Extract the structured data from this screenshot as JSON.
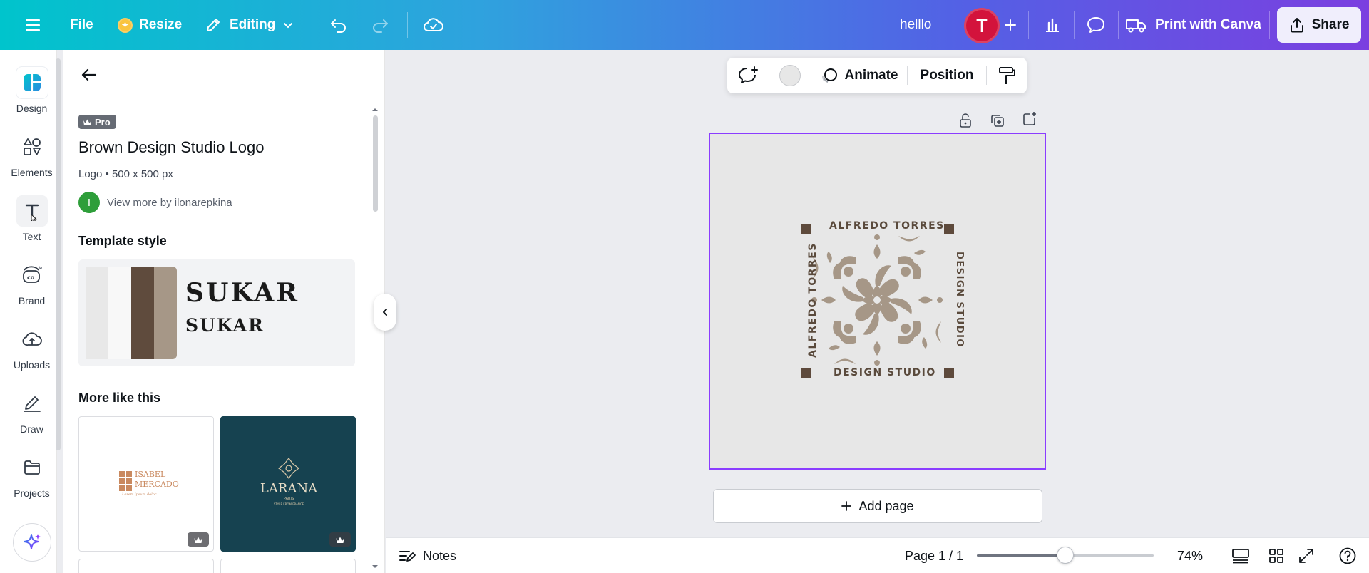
{
  "topbar": {
    "file_label": "File",
    "resize_label": "Resize",
    "editing_label": "Editing",
    "doc_title": "helllo",
    "avatar_initial": "T",
    "print_label": "Print with Canva",
    "share_label": "Share"
  },
  "rail": {
    "items": [
      {
        "label": "Design",
        "icon": "design-icon"
      },
      {
        "label": "Elements",
        "icon": "elements-icon"
      },
      {
        "label": "Text",
        "icon": "text-icon"
      },
      {
        "label": "Brand",
        "icon": "brand-icon"
      },
      {
        "label": "Uploads",
        "icon": "uploads-icon"
      },
      {
        "label": "Draw",
        "icon": "draw-icon"
      },
      {
        "label": "Projects",
        "icon": "projects-icon"
      }
    ]
  },
  "panel": {
    "pro_badge": "Pro",
    "template_title": "Brown Design Studio Logo",
    "template_meta": "Logo • 500 x 500 px",
    "author_initial": "I",
    "author_link": "View more by ilonarepkina",
    "style_heading": "Template style",
    "style_font_big": "SUKAR",
    "style_font_small": "SUKAR",
    "palette": [
      "#e8e8e8",
      "#f8f8f8",
      "#5f4b3d",
      "#a69787"
    ],
    "more_heading": "More like this",
    "thumbs": [
      {
        "line1": "ISABEL",
        "line2": "MERCADO",
        "line3": "Lorem ipsum dolor",
        "bg": "#ffffff"
      },
      {
        "line1": "LARANA",
        "line2": "PARIS",
        "line3": "STYLE FROM FRANCE",
        "bg": "#164250"
      }
    ]
  },
  "toolbar": {
    "animate_label": "Animate",
    "position_label": "Position"
  },
  "canvas": {
    "logo_top": "ALFREDO TORRES",
    "logo_bottom": "DESIGN STUDIO",
    "logo_left": "ALFREDO TORRES",
    "logo_right": "DESIGN STUDIO",
    "add_page_label": "Add page"
  },
  "bottombar": {
    "notes_label": "Notes",
    "page_indicator": "Page 1 / 1",
    "zoom_label": "74%",
    "zoom_fraction": 0.5
  },
  "colors": {
    "accent": "#8b3dff",
    "logo_brown": "#5e4a3c",
    "logo_tan": "#a69787"
  }
}
